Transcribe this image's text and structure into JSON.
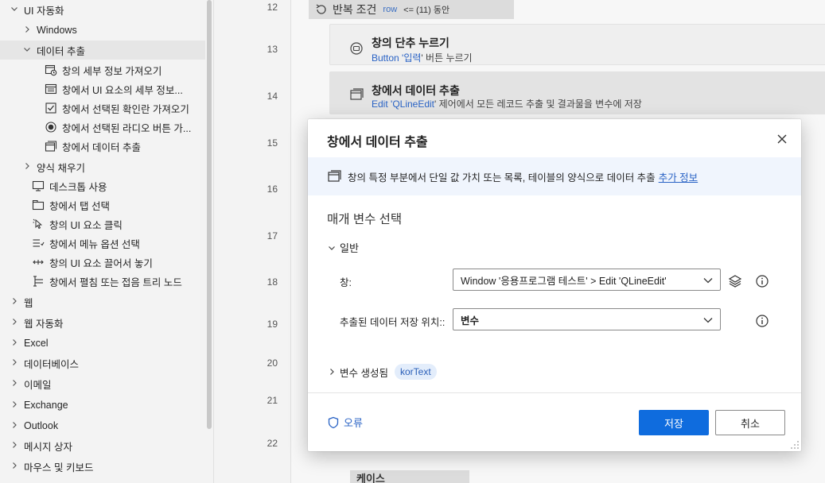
{
  "left_panel": {
    "items": [
      {
        "label": "UI 자동화",
        "chev": "⌄",
        "icon": "none"
      },
      {
        "label": "Windows",
        "chev": "›",
        "icon": "none"
      },
      {
        "label": "데이터 추출",
        "chev": "⌄",
        "icon": "none"
      },
      {
        "label": "창의 세부 정보 가져오기",
        "icon": "window-clock-icon"
      },
      {
        "label": "창에서 UI 요소의 세부 정보...",
        "icon": "window-list-icon"
      },
      {
        "label": "창에서 선택된 확인란 가져오기",
        "icon": "checkbox-icon"
      },
      {
        "label": "창에서 선택된 라디오 버튼 가...",
        "icon": "radio-icon"
      },
      {
        "label": "창에서 데이터 추출",
        "icon": "window-stack-icon"
      },
      {
        "label": "양식 채우기",
        "chev": "›",
        "icon": "none"
      },
      {
        "label": "데스크톱 사용",
        "icon": "desktop-icon"
      },
      {
        "label": "창에서 탭 선택",
        "icon": "tab-icon"
      },
      {
        "label": "창의 UI 요소 클릭",
        "icon": "pointer-icon"
      },
      {
        "label": "창에서 메뉴 옵션 선택",
        "icon": "menu-icon"
      },
      {
        "label": "창의 UI 요소 끌어서 놓기",
        "icon": "drag-icon"
      },
      {
        "label": "창에서 펼침 또는 접음 트리 노드",
        "icon": "tree-icon"
      },
      {
        "label": "웹",
        "chev": "›",
        "icon": "none"
      },
      {
        "label": "웹 자동화",
        "chev": "›",
        "icon": "none"
      },
      {
        "label": "Excel",
        "chev": "›",
        "icon": "none"
      },
      {
        "label": "데이터베이스",
        "chev": "›",
        "icon": "none"
      },
      {
        "label": "이메일",
        "chev": "›",
        "icon": "none"
      },
      {
        "label": "Exchange",
        "chev": "›",
        "icon": "none"
      },
      {
        "label": "Outlook",
        "chev": "›",
        "icon": "none"
      },
      {
        "label": "메시지 상자",
        "chev": "›",
        "icon": "none"
      },
      {
        "label": "마우스 및 키보드",
        "chev": "›",
        "icon": "none"
      }
    ]
  },
  "gutter": {
    "line_numbers": [
      "12",
      "13",
      "14",
      "15",
      "16",
      "17",
      "18",
      "19",
      "20",
      "21",
      "22"
    ]
  },
  "flow": {
    "loop_header": {
      "prefix": "반복 조건",
      "token": "row",
      "condition": "<= (11) 동안"
    },
    "actions": [
      {
        "title": "창의 단추 누르기",
        "sub_prefix": "Button '",
        "sub_blue": "입력",
        "sub_suffix": "' 버튼 누르기"
      },
      {
        "title": "창에서 데이터 추출",
        "sub_prefix": "Edit '",
        "sub_blue": "QLineEdit",
        "sub_suffix": "' 제어에서 모든 레코드 추출 및 결과물을  변수에 저장"
      }
    ],
    "bottom_case_label": "케이스"
  },
  "dialog": {
    "title": "창에서 데이터 추출",
    "info_text": "창의 특정 부분에서 단일 값 가치 또는 목록, 테이블의 양식으로 데이터 추출",
    "info_link": "추가 정보",
    "section_title": "매개 변수 선택",
    "group_label": "일반",
    "field_window_label": "창:",
    "field_window_value": "Window '응용프로그램 테스트' > Edit 'QLineEdit'",
    "field_store_label": "추출된 데이터 저장 위치::",
    "field_store_value": "변수",
    "vars_label": "변수 생성됨",
    "vars_chip": "korText",
    "error_link": "오류",
    "save_button": "저장",
    "cancel_button": "취소"
  }
}
